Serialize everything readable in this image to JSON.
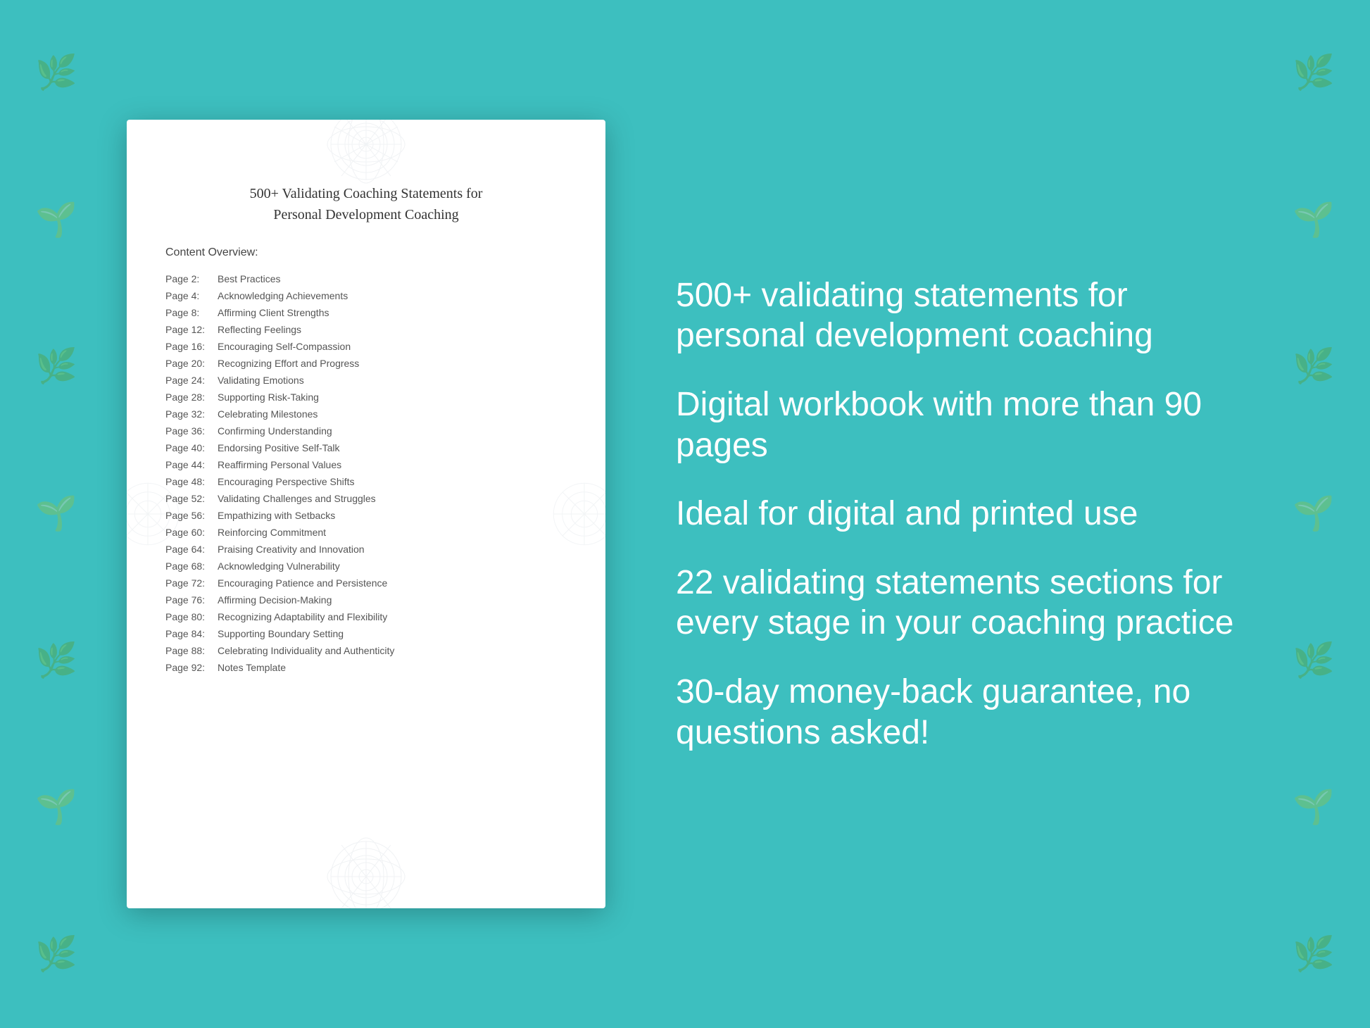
{
  "background": {
    "color": "#3dbfbf"
  },
  "document": {
    "title_line1": "500+ Validating Coaching Statements for",
    "title_line2": "Personal Development Coaching",
    "content_overview_label": "Content Overview:",
    "toc_items": [
      {
        "page": "Page  2:",
        "title": "Best Practices"
      },
      {
        "page": "Page  4:",
        "title": "Acknowledging Achievements"
      },
      {
        "page": "Page  8:",
        "title": "Affirming Client Strengths"
      },
      {
        "page": "Page 12:",
        "title": "Reflecting Feelings"
      },
      {
        "page": "Page 16:",
        "title": "Encouraging Self-Compassion"
      },
      {
        "page": "Page 20:",
        "title": "Recognizing Effort and Progress"
      },
      {
        "page": "Page 24:",
        "title": "Validating Emotions"
      },
      {
        "page": "Page 28:",
        "title": "Supporting Risk-Taking"
      },
      {
        "page": "Page 32:",
        "title": "Celebrating Milestones"
      },
      {
        "page": "Page 36:",
        "title": "Confirming Understanding"
      },
      {
        "page": "Page 40:",
        "title": "Endorsing Positive Self-Talk"
      },
      {
        "page": "Page 44:",
        "title": "Reaffirming Personal Values"
      },
      {
        "page": "Page 48:",
        "title": "Encouraging Perspective Shifts"
      },
      {
        "page": "Page 52:",
        "title": "Validating Challenges and Struggles"
      },
      {
        "page": "Page 56:",
        "title": "Empathizing with Setbacks"
      },
      {
        "page": "Page 60:",
        "title": "Reinforcing Commitment"
      },
      {
        "page": "Page 64:",
        "title": "Praising Creativity and Innovation"
      },
      {
        "page": "Page 68:",
        "title": "Acknowledging Vulnerability"
      },
      {
        "page": "Page 72:",
        "title": "Encouraging Patience and Persistence"
      },
      {
        "page": "Page 76:",
        "title": "Affirming Decision-Making"
      },
      {
        "page": "Page 80:",
        "title": "Recognizing Adaptability and Flexibility"
      },
      {
        "page": "Page 84:",
        "title": "Supporting Boundary Setting"
      },
      {
        "page": "Page 88:",
        "title": "Celebrating Individuality and Authenticity"
      },
      {
        "page": "Page 92:",
        "title": "Notes Template"
      }
    ]
  },
  "features": [
    {
      "id": "feature1",
      "text": "500+ validating statements for personal development coaching"
    },
    {
      "id": "feature2",
      "text": "Digital workbook with more than 90 pages"
    },
    {
      "id": "feature3",
      "text": "Ideal for digital and printed use"
    },
    {
      "id": "feature4",
      "text": "22 validating statements sections for every stage in your coaching practice"
    },
    {
      "id": "feature5",
      "text": "30-day money-back guarantee, no questions asked!"
    }
  ]
}
